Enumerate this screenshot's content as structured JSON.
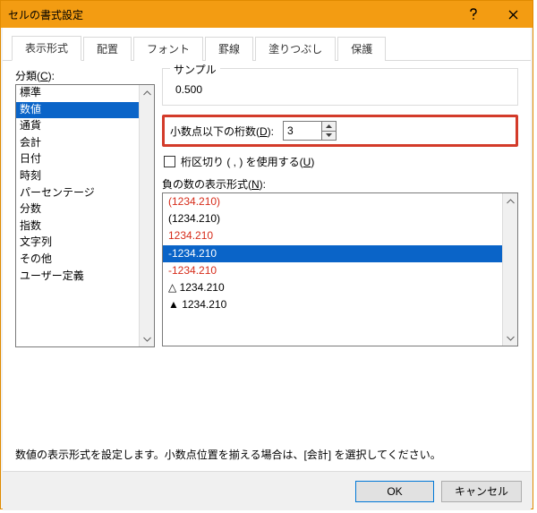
{
  "window": {
    "title": "セルの書式設定"
  },
  "tabs": {
    "display": "表示形式",
    "alignment": "配置",
    "font": "フォント",
    "border": "罫線",
    "fill": "塗りつぶし",
    "protect": "保護"
  },
  "category": {
    "label_prefix": "分類(",
    "label_mnemonic": "C",
    "label_suffix": "):",
    "items": [
      "標準",
      "数値",
      "通貨",
      "会計",
      "日付",
      "時刻",
      "パーセンテージ",
      "分数",
      "指数",
      "文字列",
      "その他",
      "ユーザー定義"
    ],
    "selected_index": 1
  },
  "sample": {
    "label": "サンプル",
    "value": "0.500"
  },
  "decimals": {
    "label_prefix": "小数点以下の桁数(",
    "label_mnemonic": "D",
    "label_suffix": "):",
    "value": "3"
  },
  "separator": {
    "label_prefix": "桁区切り ( , ) を使用する(",
    "label_mnemonic": "U",
    "label_suffix": ")"
  },
  "negative": {
    "label_prefix": "負の数の表示形式(",
    "label_mnemonic": "N",
    "label_suffix": "):",
    "items": [
      {
        "text": "(1234.210)",
        "red": true
      },
      {
        "text": "(1234.210)",
        "red": false
      },
      {
        "text": "1234.210",
        "red": true
      },
      {
        "text": "-1234.210",
        "red": false,
        "selected": true
      },
      {
        "text": "-1234.210",
        "red": true
      },
      {
        "text": "△ 1234.210",
        "red": false
      },
      {
        "text": "▲ 1234.210",
        "red": false
      }
    ]
  },
  "hint": "数値の表示形式を設定します。小数点位置を揃える場合は、[会計] を選択してください。",
  "buttons": {
    "ok": "OK",
    "cancel": "キャンセル"
  }
}
